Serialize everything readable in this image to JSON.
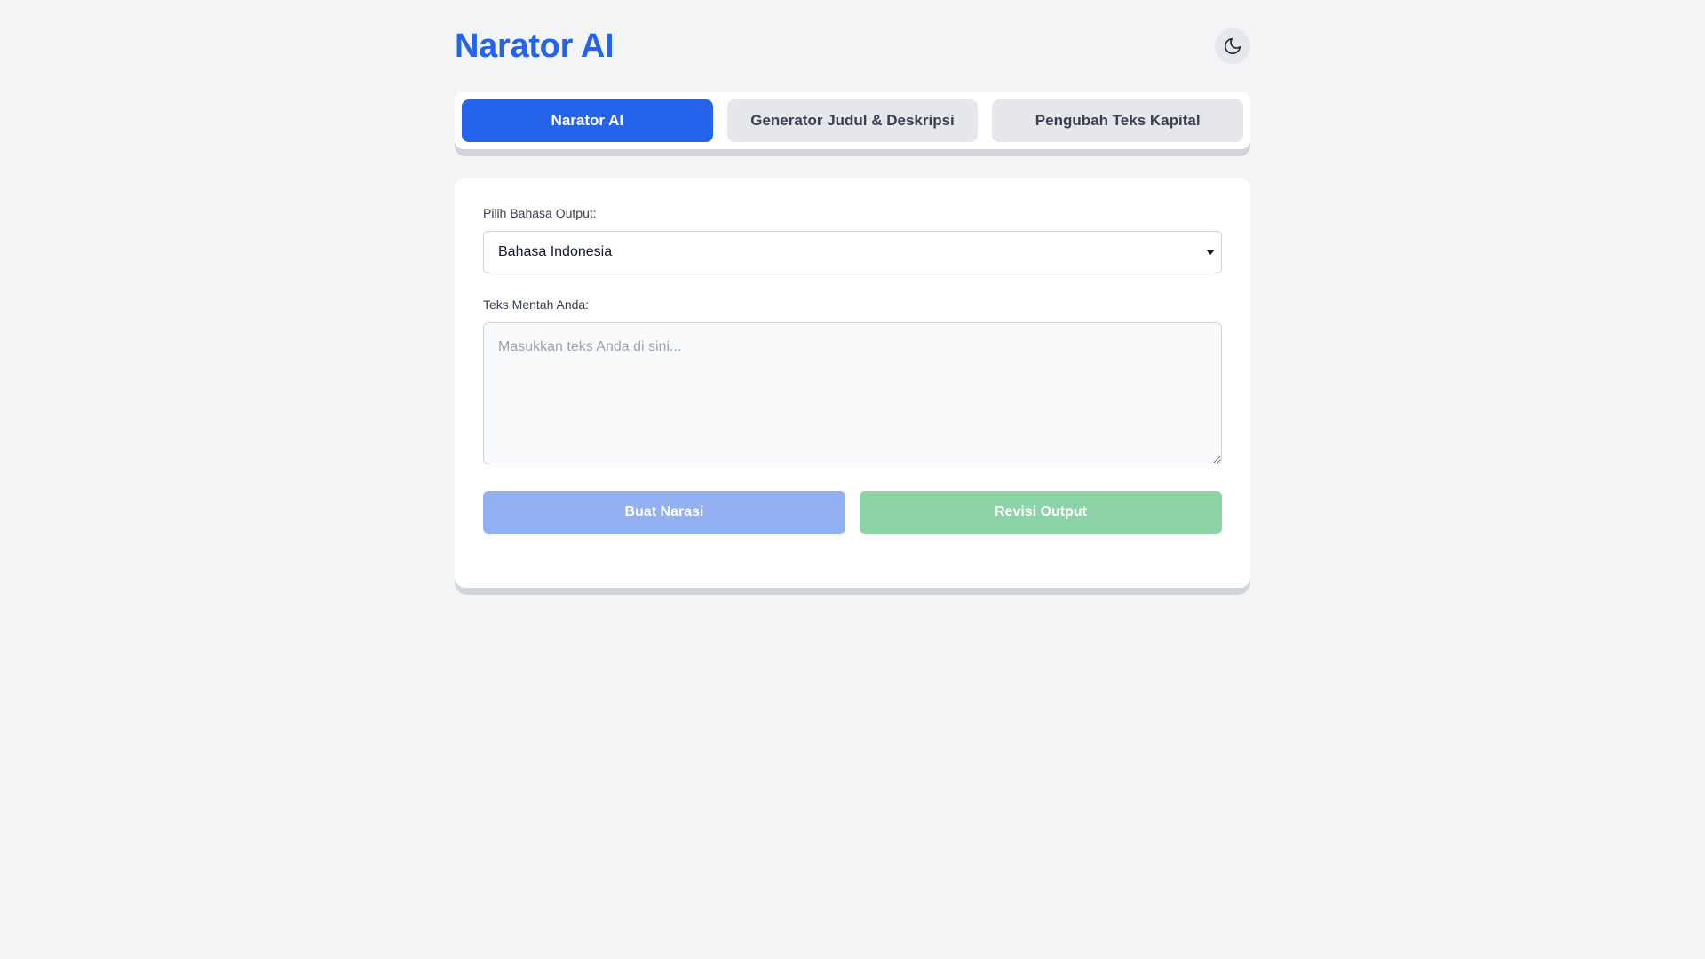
{
  "app": {
    "title": "Narator AI",
    "theme_toggle_icon": "moon-icon"
  },
  "tabs": [
    {
      "label": "Narator AI",
      "active": true
    },
    {
      "label": "Generator Judul & Deskripsi",
      "active": false
    },
    {
      "label": "Pengubah Teks Kapital",
      "active": false
    }
  ],
  "form": {
    "language_label": "Pilih Bahasa Output:",
    "language_value": "Bahasa Indonesia",
    "text_label": "Teks Mentah Anda:",
    "text_value": "",
    "text_placeholder": "Masukkan teks Anda di sini..."
  },
  "actions": {
    "generate_label": "Buat Narasi",
    "revise_label": "Revisi Output"
  },
  "colors": {
    "accent": "#2563eb",
    "generate_button": "#93b0f3",
    "revise_button": "#8cd3a5",
    "background": "#f3f4f6"
  }
}
